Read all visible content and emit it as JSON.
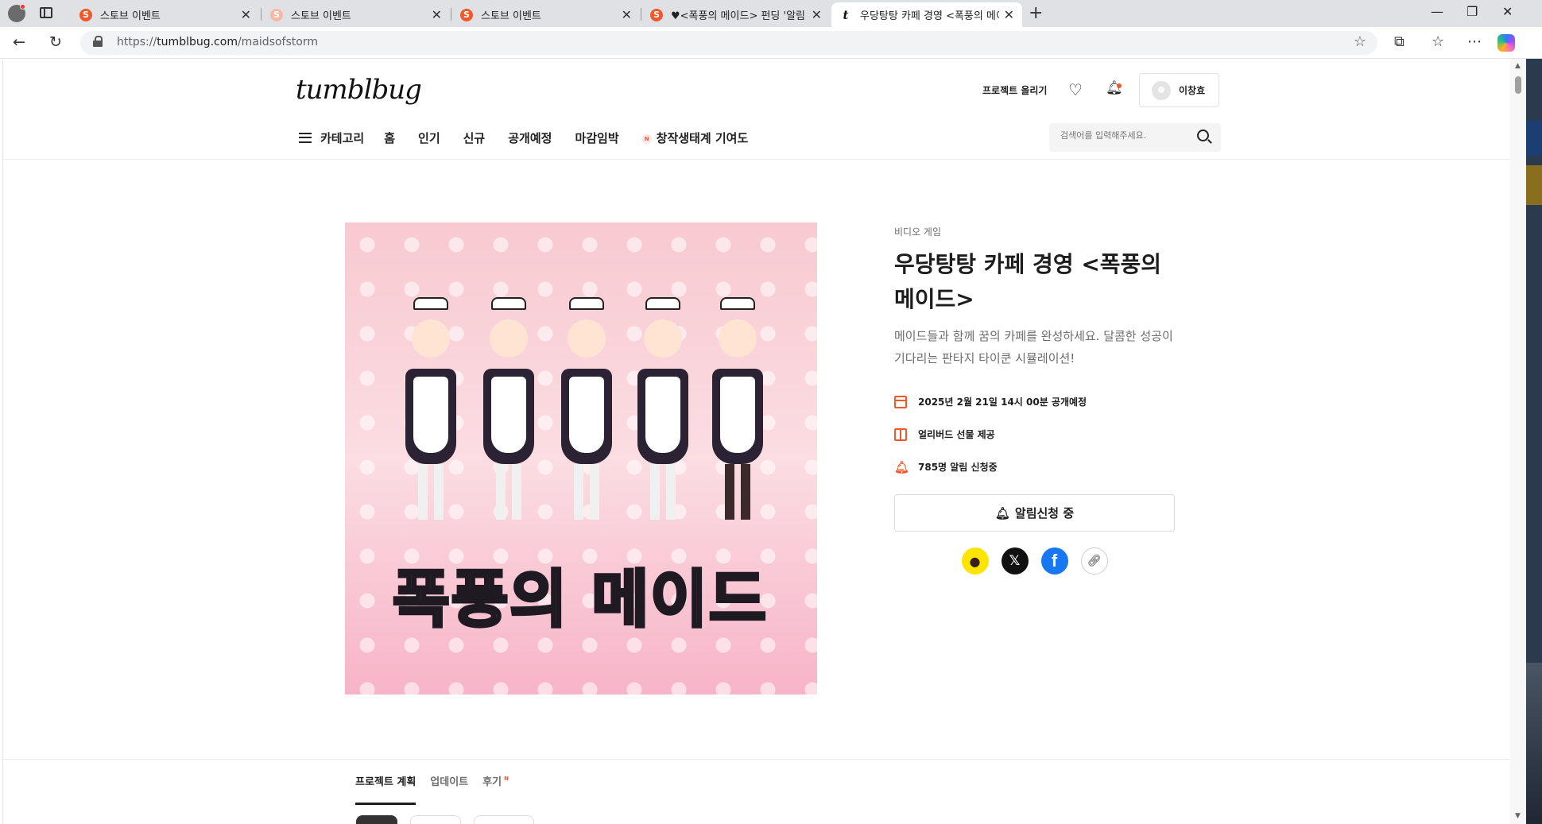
{
  "browser": {
    "tabs": [
      {
        "title": "스토브 이벤트",
        "favicon": "S"
      },
      {
        "title": "스토브 이벤트",
        "favicon": "S"
      },
      {
        "title": "스토브 이벤트",
        "favicon": "S"
      },
      {
        "title": "♥<폭풍의 메이드> 펀딩 '알림 신",
        "favicon": "S"
      },
      {
        "title": "우당탕탕 카페 경영 <폭풍의 메이드>",
        "favicon": "t"
      }
    ],
    "active_tab_index": 4,
    "url": {
      "scheme": "https://",
      "host": "tumblbug.com",
      "path": "/maidsofstorm"
    }
  },
  "header": {
    "logo": "tumblbug",
    "upload_project": "프로젝트 올리기",
    "user_name": "이창효",
    "nav": {
      "categories": "카테고리",
      "items": [
        "홈",
        "인기",
        "신규",
        "공개예정",
        "마감임박"
      ],
      "special_badge": "N",
      "special_label": "창작생태계 기여도"
    },
    "search_placeholder": "검색어를 입력해주세요."
  },
  "project": {
    "cover_title": "폭풍의 메이드",
    "category": "비디오 게임",
    "title": "우당탕탕 카페 경영 <폭풍의 메이드>",
    "description": "메이드들과 함께 꿈의 카페를 완성하세요. 달콤한 성공이 기다리는 판타지 타이쿤 시뮬레이션!",
    "meta": {
      "launch": "2025년 2월 21일 14시 00분 공개예정",
      "early_bird": "얼리버드 선물 제공",
      "subscribers": "785명 알림 신청중"
    },
    "notify_button": "알림신청 중",
    "share": [
      "kakaotalk",
      "x",
      "facebook",
      "link"
    ]
  },
  "page_tabs": {
    "items": [
      "프로젝트 계획",
      "업데이트",
      "후기"
    ],
    "review_badge": "N",
    "active": "프로젝트 계획"
  },
  "colors": {
    "accent": "#f1592a",
    "kakao": "#fee500",
    "facebook": "#1877f2"
  }
}
